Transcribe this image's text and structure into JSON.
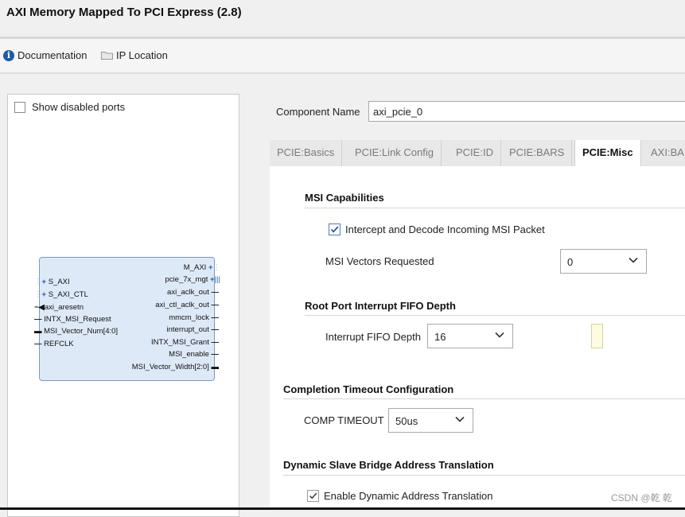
{
  "window": {
    "title": "AXI Memory Mapped To PCI Express (2.8)"
  },
  "toolbar": {
    "documentation": "Documentation",
    "ip_location": "IP Location"
  },
  "left_panel": {
    "show_disabled_ports": "Show disabled ports",
    "block": {
      "left_pins": [
        "S_AXI",
        "S_AXI_CTL",
        "axi_aresetn",
        "INTX_MSI_Request",
        "MSI_Vector_Num[4:0]",
        "REFCLK"
      ],
      "right_pins": [
        "M_AXI",
        "pcie_7x_mgt",
        "axi_aclk_out",
        "axi_ctl_aclk_out",
        "mmcm_lock",
        "interrupt_out",
        "INTX_MSI_Grant",
        "MSI_enable",
        "MSI_Vector_Width[2:0]"
      ]
    }
  },
  "component": {
    "label": "Component Name",
    "value": "axi_pcie_0"
  },
  "tabs": [
    "PCIE:Basics",
    "PCIE:Link Config",
    "PCIE:ID",
    "PCIE:BARS",
    "PCIE:Misc",
    "AXI:BAI"
  ],
  "active_tab": "PCIE:Misc",
  "misc": {
    "msi_capabilities": {
      "title": "MSI Capabilities",
      "intercept_label": "Intercept and Decode Incoming MSI Packet",
      "vectors_label": "MSI Vectors Requested",
      "vectors_value": "0"
    },
    "root_port": {
      "title": "Root Port Interrupt FIFO Depth",
      "depth_label": "Interrupt FIFO Depth",
      "depth_value": "16"
    },
    "completion_timeout": {
      "title": "Completion Timeout Configuration",
      "label": "COMP TIMEOUT",
      "value": "50us"
    },
    "dynamic_bridge": {
      "title": "Dynamic Slave Bridge Address Translation",
      "enable_label": "Enable Dynamic Address Translation"
    }
  },
  "watermark": "CSDN @乾 乾"
}
